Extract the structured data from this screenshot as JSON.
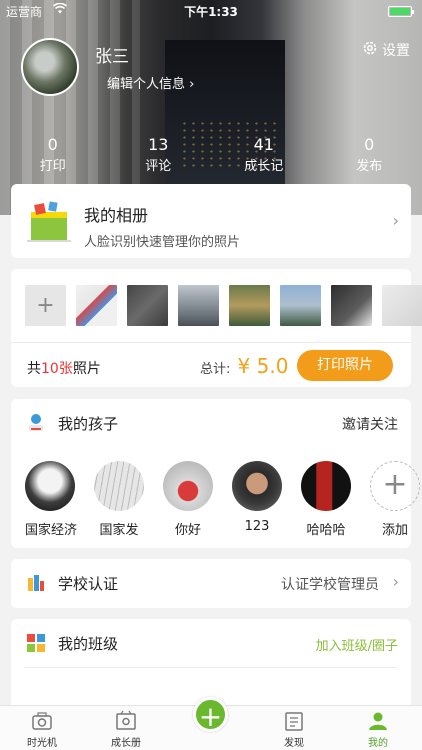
{
  "status_bar": {
    "carrier": "运营商",
    "time": "下午1:33"
  },
  "profile": {
    "name": "张三",
    "edit_label": "编辑个人信息",
    "settings_label": "设置"
  },
  "stats": [
    {
      "value": "0",
      "label": "打印"
    },
    {
      "value": "13",
      "label": "评论"
    },
    {
      "value": "41",
      "label": "成长记"
    },
    {
      "value": "0",
      "label": "发布"
    }
  ],
  "album": {
    "title": "我的相册",
    "subtitle": "人脸识别快速管理你的照片"
  },
  "photos": {
    "count_prefix": "共",
    "count": "10张",
    "count_suffix": "照片",
    "total_label": "总计:",
    "currency": "¥",
    "total": "5.0",
    "print_button": "打印照片",
    "add_symbol": "+"
  },
  "kids": {
    "title": "我的孩子",
    "action": "邀请关注",
    "items": [
      {
        "name": "国家经济"
      },
      {
        "name": "国家发"
      },
      {
        "name": "你好"
      },
      {
        "name": "123"
      },
      {
        "name": "哈哈哈"
      },
      {
        "name": "添加"
      }
    ]
  },
  "school": {
    "title": "学校认证",
    "action": "认证学校管理员"
  },
  "class": {
    "title": "我的班级",
    "action": "加入班级/圈子"
  },
  "tabbar": {
    "items": [
      {
        "label": "时光机"
      },
      {
        "label": "成长册"
      },
      {
        "label": "发现"
      },
      {
        "label": "我的"
      }
    ],
    "plus": "+"
  },
  "colors": {
    "accent": "#f39c19",
    "tab_active": "#5aa02c",
    "plus": "#6ab82d",
    "count_red": "#e33333"
  }
}
